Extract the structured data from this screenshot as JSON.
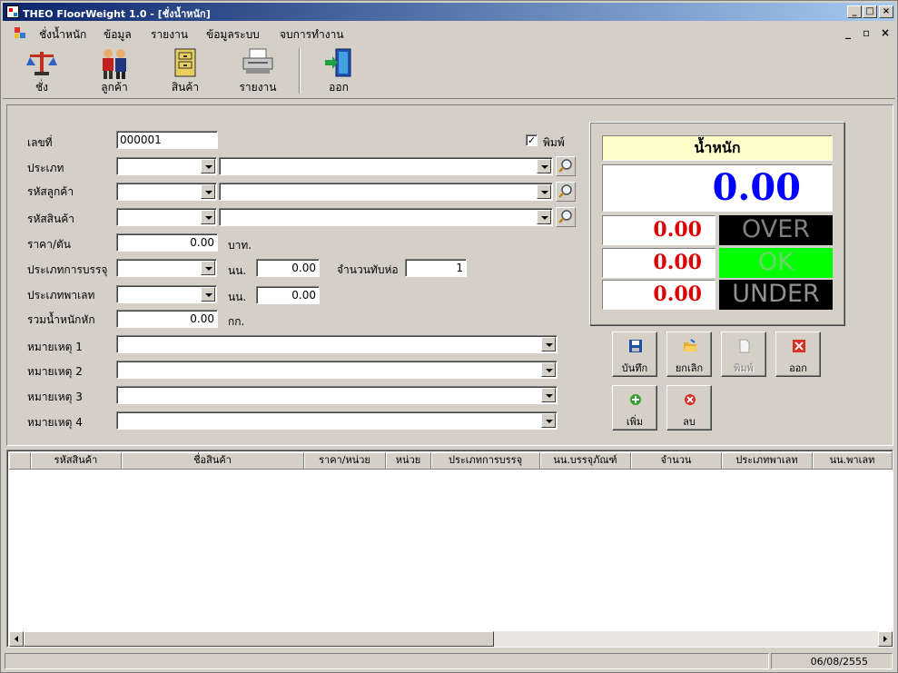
{
  "window": {
    "title": "THEO FloorWeight 1.0 - [ชั่งน้ำหนัก]"
  },
  "menu": {
    "items": [
      "ชั่งน้ำหนัก",
      "ข้อมูล",
      "รายงาน",
      "ข้อมูลระบบ",
      "จบการทำงาน"
    ]
  },
  "toolbar": {
    "weigh": "ชั่ง",
    "customer": "ลูกค้า",
    "product": "สินค้า",
    "report": "รายงาน",
    "exit": "ออก"
  },
  "form": {
    "doc_no_label": "เลขที่",
    "doc_no": "000001",
    "print_label": "พิมพ์",
    "print_checked": true,
    "type_label": "ประเภท",
    "customer_code_label": "รหัสลูกค้า",
    "product_code_label": "รหัสสินค้า",
    "price_label": "ราคา/ตัน",
    "price": "0.00",
    "price_unit": "บาท.",
    "packaging_type_label": "ประเภทการบรรจุ",
    "packaging_weight_unit": "นน.",
    "packaging_weight": "0.00",
    "pack_count_label": "จำนวนทับห่อ",
    "pack_count": "1",
    "pallet_type_label": "ประเภทพาเลท",
    "pallet_weight_unit": "นน.",
    "pallet_weight": "0.00",
    "total_deduct_label": "รวมน้ำหนักหัก",
    "total_deduct": "0.00",
    "total_deduct_unit": "กก.",
    "note1_label": "หมายเหตุ 1",
    "note2_label": "หมายเหตุ 2",
    "note3_label": "หมายเหตุ 3",
    "note4_label": "หมายเหตุ 4"
  },
  "weight": {
    "title": "น้ำหนัก",
    "value": "0.00",
    "over_value": "0.00",
    "ok_value": "0.00",
    "under_value": "0.00",
    "over_label": "OVER",
    "ok_label": "OK",
    "under_label": "UNDER",
    "colors": {
      "value": "#0000ff",
      "limits": "#dd0000",
      "over_bg": "#000000",
      "ok_bg": "#00ff00",
      "under_bg": "#000000",
      "title_bg": "#ffffcc"
    }
  },
  "actions": {
    "save": "บันทึก",
    "cancel": "ยกเลิก",
    "print": "พิมพ์",
    "exit": "ออก",
    "add": "เพิ่ม",
    "delete": "ลบ"
  },
  "grid": {
    "columns": [
      "รหัสสินค้า",
      "ชื่อสินค้า",
      "ราคา/หน่วย",
      "หน่วย",
      "ประเภทการบรรจุ",
      "นน.บรรจุภัณฑ์",
      "จำนวน",
      "ประเภทพาเลท",
      "นน.พาเลท"
    ],
    "rows": []
  },
  "status": {
    "date": "06/08/2555"
  }
}
